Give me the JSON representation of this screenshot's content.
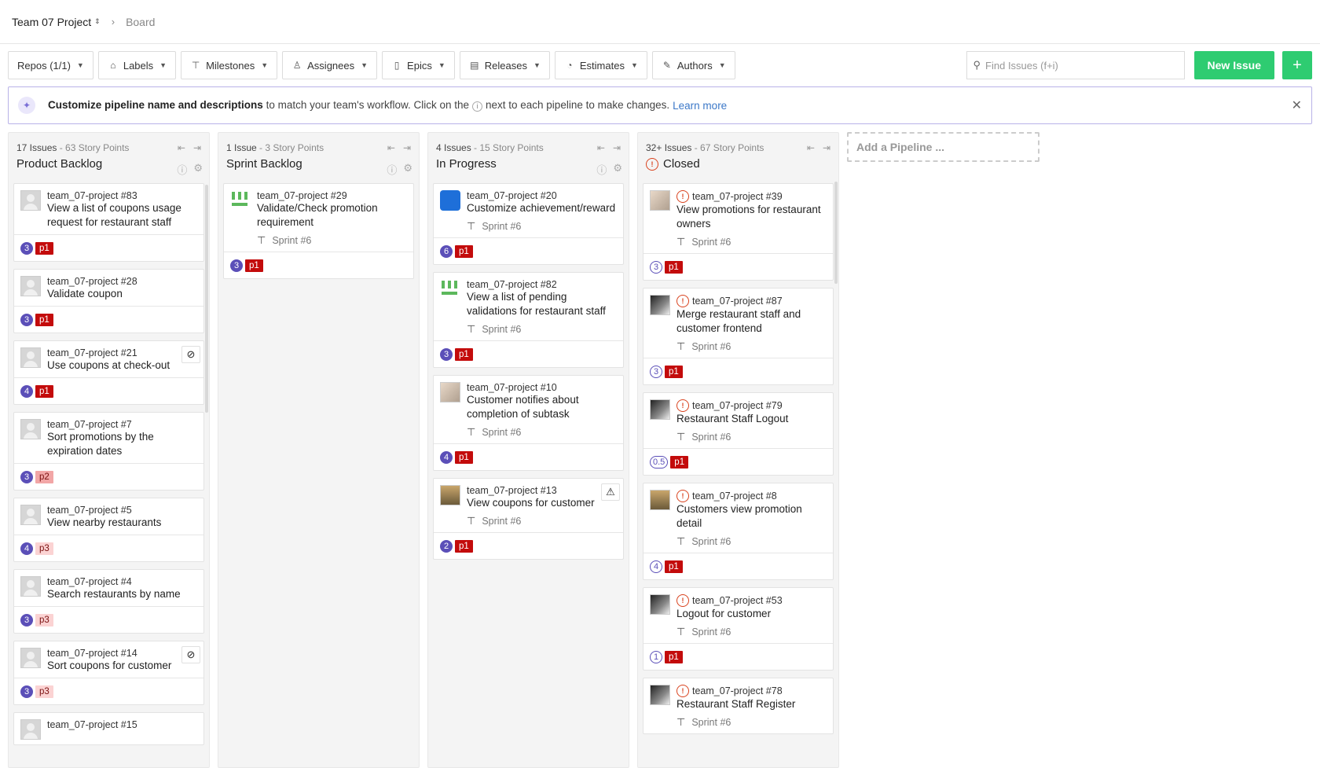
{
  "topbar": {
    "project": "Team 07 Project",
    "breadcrumb": "Board"
  },
  "filters": [
    {
      "label": "Repos (1/1)",
      "icon": ""
    },
    {
      "label": "Labels",
      "icon": "tag-icon"
    },
    {
      "label": "Milestones",
      "icon": "signpost-icon"
    },
    {
      "label": "Assignees",
      "icon": "person-icon"
    },
    {
      "label": "Epics",
      "icon": "book-icon"
    },
    {
      "label": "Releases",
      "icon": "document-icon"
    },
    {
      "label": "Estimates",
      "icon": "gauge-icon"
    },
    {
      "label": "Authors",
      "icon": "pencil-icon"
    }
  ],
  "search": {
    "placeholder": "Find Issues (f+i)"
  },
  "new_issue": "New Issue",
  "banner": {
    "bold": "Customize pipeline name and descriptions",
    "text1": " to match your team's workflow. Click on the",
    "text2": "next to each pipeline to make changes.",
    "link": "Learn more"
  },
  "add_pipeline": "Add a Pipeline ...",
  "pipelines": [
    {
      "count": "17 Issues",
      "points": "- 63 Story Points",
      "name": "Product Backlog",
      "cards": [
        {
          "ref": "team_07-project #83",
          "title": "View a list of coupons usage request for restaurant staff",
          "est": "3",
          "label": "p1"
        },
        {
          "ref": "team_07-project #28",
          "title": "Validate coupon",
          "est": "3",
          "label": "p1"
        },
        {
          "ref": "team_07-project #21",
          "title": "Use coupons at check-out",
          "est": "4",
          "label": "p1"
        },
        {
          "ref": "team_07-project #7",
          "title": "Sort promotions by the expiration dates",
          "est": "3",
          "label": "p2"
        },
        {
          "ref": "team_07-project #5",
          "title": "View nearby restaurants",
          "est": "4",
          "label": "p3"
        },
        {
          "ref": "team_07-project #4",
          "title": "Search restaurants by name",
          "est": "3",
          "label": "p3"
        },
        {
          "ref": "team_07-project #14",
          "title": "Sort coupons for customer",
          "est": "3",
          "label": "p3"
        },
        {
          "ref": "team_07-project #15",
          "title": ""
        }
      ]
    },
    {
      "count": "1 Issue",
      "points": "- 3 Story Points",
      "name": "Sprint Backlog",
      "cards": [
        {
          "ref": "team_07-project #29",
          "title": "Validate/Check promotion requirement",
          "sprint": "Sprint #6",
          "est": "3",
          "label": "p1"
        }
      ]
    },
    {
      "count": "4 Issues",
      "points": "- 15 Story Points",
      "name": "In Progress",
      "cards": [
        {
          "ref": "team_07-project #20",
          "title": "Customize achievement/reward",
          "sprint": "Sprint #6",
          "est": "6",
          "label": "p1"
        },
        {
          "ref": "team_07-project #82",
          "title": "View a list of pending validations for restaurant staff",
          "sprint": "Sprint #6",
          "est": "3",
          "label": "p1"
        },
        {
          "ref": "team_07-project #10",
          "title": "Customer notifies about completion of subtask",
          "sprint": "Sprint #6",
          "est": "4",
          "label": "p1"
        },
        {
          "ref": "team_07-project #13",
          "title": "View coupons for customer",
          "sprint": "Sprint #6",
          "est": "2",
          "label": "p1"
        }
      ]
    },
    {
      "count": "32+ Issues",
      "points": "- 67 Story Points",
      "name": "Closed",
      "cards": [
        {
          "ref": "team_07-project #39",
          "title": "View promotions for restaurant owners",
          "sprint": "Sprint #6",
          "est": "3",
          "label": "p1"
        },
        {
          "ref": "team_07-project #87",
          "title": "Merge restaurant staff and customer frontend",
          "sprint": "Sprint #6",
          "est": "3",
          "label": "p1"
        },
        {
          "ref": "team_07-project #79",
          "title": "Restaurant Staff Logout",
          "sprint": "Sprint #6",
          "est": "0.5",
          "label": "p1"
        },
        {
          "ref": "team_07-project #8",
          "title": "Customers view promotion detail",
          "sprint": "Sprint #6",
          "est": "4",
          "label": "p1"
        },
        {
          "ref": "team_07-project #53",
          "title": "Logout for customer",
          "sprint": "Sprint #6",
          "est": "1",
          "label": "p1"
        },
        {
          "ref": "team_07-project #78",
          "title": "Restaurant Staff Register",
          "sprint": "Sprint #6"
        }
      ]
    }
  ]
}
